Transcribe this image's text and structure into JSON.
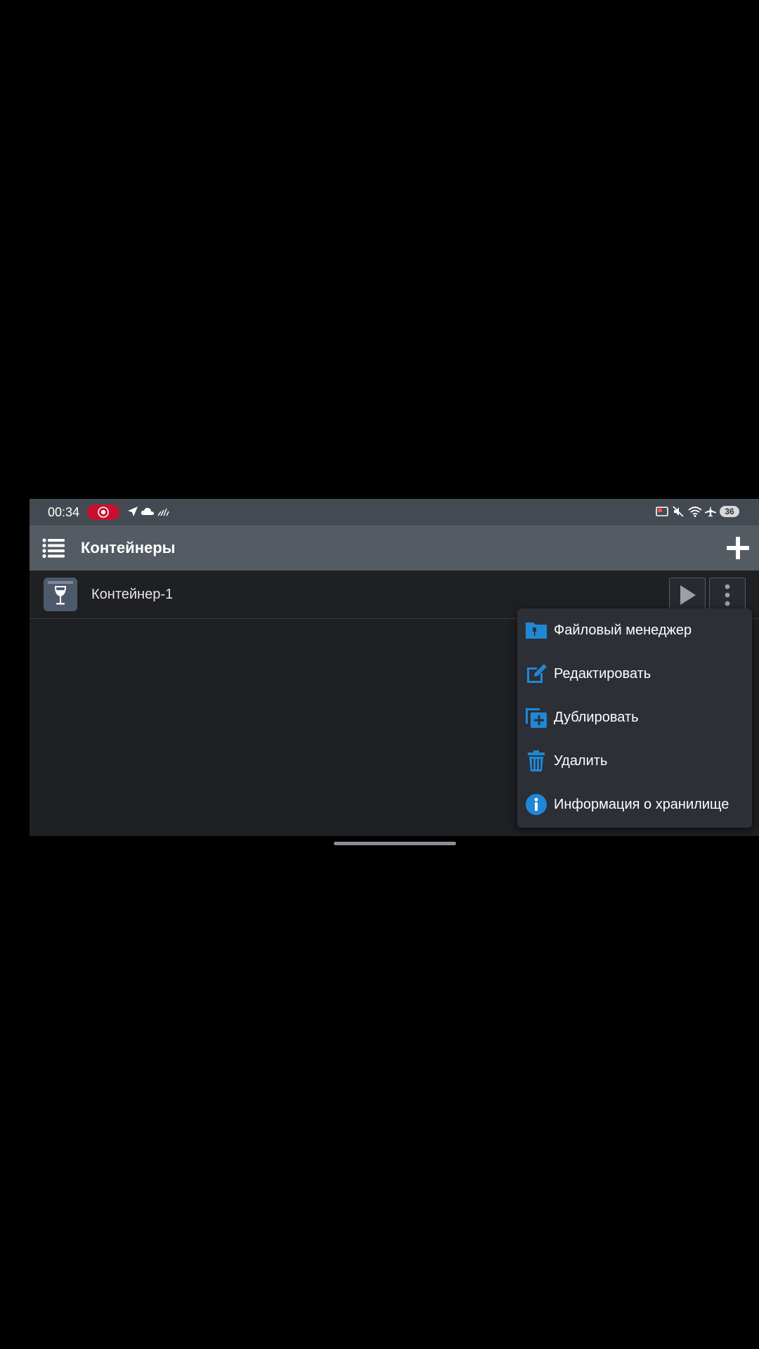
{
  "status_bar": {
    "time": "00:34",
    "battery": "36",
    "left_icons": [
      "record-icon",
      "navigation-icon",
      "cloud-icon",
      "signal-bars-icon"
    ],
    "right_icons": [
      "cast-icon",
      "mute-icon",
      "wifi-icon",
      "airplane-icon",
      "battery-icon"
    ]
  },
  "app_bar": {
    "title": "Контейнеры",
    "menu_icon": "list-menu-icon",
    "add_icon": "plus-icon"
  },
  "containers": [
    {
      "name": "Контейнер-1",
      "icon": "wine-glass-box-icon"
    }
  ],
  "context_menu": {
    "accent_color": "#1e88d6",
    "items": [
      {
        "label": "Файловый менеджер",
        "icon": "folder-icon"
      },
      {
        "label": "Редактировать",
        "icon": "edit-icon"
      },
      {
        "label": "Дублировать",
        "icon": "duplicate-icon"
      },
      {
        "label": "Удалить",
        "icon": "trash-icon"
      },
      {
        "label": "Информация о хранилище",
        "icon": "info-icon"
      }
    ]
  },
  "colors": {
    "background": "#1f2024",
    "status_bar": "#444a52",
    "app_bar": "#555b63",
    "menu_background": "#2c2f36",
    "recording": "#c8102e"
  }
}
